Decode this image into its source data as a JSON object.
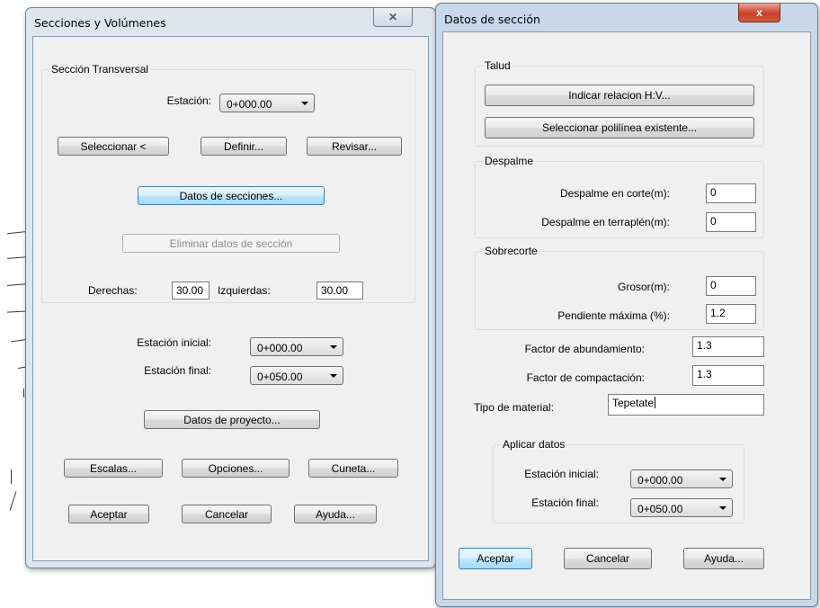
{
  "window1": {
    "title": "Secciones y Volúmenes",
    "group_seccion": {
      "label": "Sección Transversal",
      "estacion_label": "Estación:",
      "estacion_value": "0+000.00",
      "btn_seleccionar": "Seleccionar <",
      "btn_definir": "Definir...",
      "btn_revisar": "Revisar...",
      "btn_datos_secciones": "Datos de secciones...",
      "btn_eliminar": "Eliminar datos de sección",
      "derechas_label": "Derechas:",
      "derechas_value": "30.00",
      "izquierdas_label": "Izquierdas:",
      "izquierdas_value": "30.00"
    },
    "estacion_inicial_label": "Estación inicial:",
    "estacion_inicial_value": "0+000.00",
    "estacion_final_label": "Estación final:",
    "estacion_final_value": "0+050.00",
    "btn_datos_proyecto": "Datos de proyecto...",
    "btn_escalas": "Escalas...",
    "btn_opciones": "Opciones...",
    "btn_cuneta": "Cuneta...",
    "btn_aceptar": "Aceptar",
    "btn_cancelar": "Cancelar",
    "btn_ayuda": "Ayuda...",
    "close_glyph": "✕"
  },
  "window2": {
    "title": "Datos de sección",
    "group_talud": {
      "label": "Talud",
      "btn_indicar": "Indicar relacion H:V...",
      "btn_seleccionar_polilinea": "Seleccionar polilínea existente..."
    },
    "group_despalme": {
      "label": "Despalme",
      "corte_label": "Despalme en corte(m):",
      "corte_value": "0",
      "terraplen_label": "Despalme en terraplén(m):",
      "terraplen_value": "0"
    },
    "group_sobrecorte": {
      "label": "Sobrecorte",
      "grosor_label": "Grosor(m):",
      "grosor_value": "0",
      "pendiente_label": "Pendiente máxima (%):",
      "pendiente_value": "1.2"
    },
    "factor_abundamiento_label": "Factor de abundamiento:",
    "factor_abundamiento_value": "1.3",
    "factor_compactacion_label": "Factor de compactación:",
    "factor_compactacion_value": "1.3",
    "tipo_material_label": "Tipo de material:",
    "tipo_material_value": "Tepetate",
    "group_aplicar": {
      "label": "Aplicar datos",
      "estacion_inicial_label": "Estación inicial:",
      "estacion_inicial_value": "0+000.00",
      "estacion_final_label": "Estación final:",
      "estacion_final_value": "0+050.00"
    },
    "btn_aceptar": "Aceptar",
    "btn_cancelar": "Cancelar",
    "btn_ayuda": "Ayuda...",
    "close_glyph": "x"
  }
}
